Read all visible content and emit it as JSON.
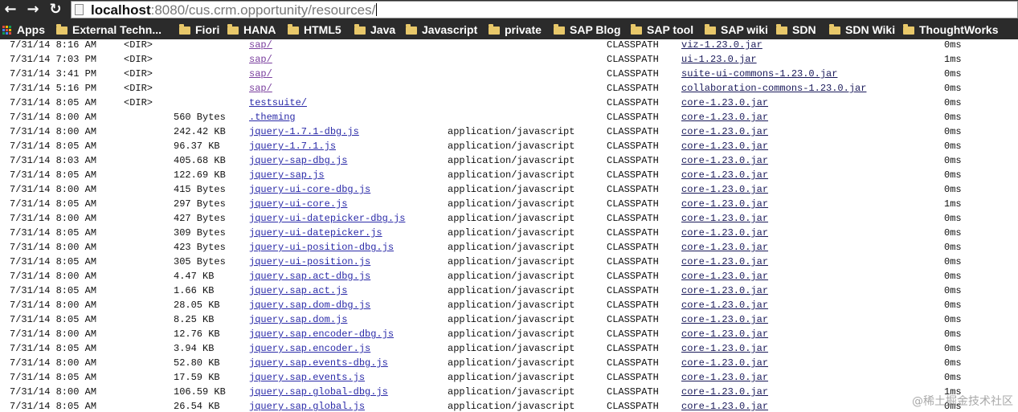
{
  "browser": {
    "back_icon": "←",
    "forward_icon": "→",
    "reload_icon": "↻",
    "url_host": "localhost",
    "url_rest": ":8080/cus.crm.opportunity/resources/"
  },
  "bookmarks": [
    {
      "label": "Apps",
      "icon": "apps-grid-icon"
    },
    {
      "label": "External Techn...",
      "icon": "folder-icon"
    },
    {
      "label": "Fiori",
      "icon": "folder-icon"
    },
    {
      "label": "HANA",
      "icon": "folder-icon"
    },
    {
      "label": "HTML5",
      "icon": "folder-icon"
    },
    {
      "label": "Java",
      "icon": "folder-icon"
    },
    {
      "label": "Javascript",
      "icon": "folder-icon"
    },
    {
      "label": "private",
      "icon": "folder-icon"
    },
    {
      "label": "SAP Blog",
      "icon": "folder-icon"
    },
    {
      "label": "SAP tool",
      "icon": "folder-icon"
    },
    {
      "label": "SAP wiki",
      "icon": "folder-icon"
    },
    {
      "label": "SDN",
      "icon": "folder-icon"
    },
    {
      "label": "SDN Wiki",
      "icon": "folder-icon"
    },
    {
      "label": "ThoughtWorks",
      "icon": "folder-icon"
    }
  ],
  "rows": [
    {
      "date": "7/31/14 8:16 AM",
      "dir": "<DIR>",
      "size": "",
      "name": "sap/",
      "mime": "",
      "cp": "CLASSPATH",
      "jar": "viz-1.23.0.jar",
      "time": "0ms"
    },
    {
      "date": "7/31/14 7:03 PM",
      "dir": "<DIR>",
      "size": "",
      "name": "sap/",
      "mime": "",
      "cp": "CLASSPATH",
      "jar": "ui-1.23.0.jar",
      "time": "1ms"
    },
    {
      "date": "7/31/14 3:41 PM",
      "dir": "<DIR>",
      "size": "",
      "name": "sap/",
      "mime": "",
      "cp": "CLASSPATH",
      "jar": "suite-ui-commons-1.23.0.jar",
      "time": "0ms"
    },
    {
      "date": "7/31/14 5:16 PM",
      "dir": "<DIR>",
      "size": "",
      "name": "sap/",
      "mime": "",
      "cp": "CLASSPATH",
      "jar": "collaboration-commons-1.23.0.jar",
      "time": "0ms"
    },
    {
      "date": "7/31/14 8:05 AM",
      "dir": "<DIR>",
      "size": "",
      "name": "testsuite/",
      "mime": "",
      "cp": "CLASSPATH",
      "jar": "core-1.23.0.jar",
      "time": "0ms"
    },
    {
      "date": "7/31/14 8:00 AM",
      "dir": "",
      "size": "560 Bytes",
      "name": ".theming",
      "mime": "",
      "cp": "CLASSPATH",
      "jar": "core-1.23.0.jar",
      "time": "0ms"
    },
    {
      "date": "7/31/14 8:00 AM",
      "dir": "",
      "size": "242.42 KB",
      "name": "jquery-1.7.1-dbg.js",
      "mime": "application/javascript",
      "cp": "CLASSPATH",
      "jar": "core-1.23.0.jar",
      "time": "0ms"
    },
    {
      "date": "7/31/14 8:05 AM",
      "dir": "",
      "size": "96.37 KB",
      "name": "jquery-1.7.1.js",
      "mime": "application/javascript",
      "cp": "CLASSPATH",
      "jar": "core-1.23.0.jar",
      "time": "0ms"
    },
    {
      "date": "7/31/14 8:03 AM",
      "dir": "",
      "size": "405.68 KB",
      "name": "jquery-sap-dbg.js",
      "mime": "application/javascript",
      "cp": "CLASSPATH",
      "jar": "core-1.23.0.jar",
      "time": "0ms"
    },
    {
      "date": "7/31/14 8:05 AM",
      "dir": "",
      "size": "122.69 KB",
      "name": "jquery-sap.js",
      "mime": "application/javascript",
      "cp": "CLASSPATH",
      "jar": "core-1.23.0.jar",
      "time": "0ms"
    },
    {
      "date": "7/31/14 8:00 AM",
      "dir": "",
      "size": "415 Bytes",
      "name": "jquery-ui-core-dbg.js",
      "mime": "application/javascript",
      "cp": "CLASSPATH",
      "jar": "core-1.23.0.jar",
      "time": "0ms"
    },
    {
      "date": "7/31/14 8:05 AM",
      "dir": "",
      "size": "297 Bytes",
      "name": "jquery-ui-core.js",
      "mime": "application/javascript",
      "cp": "CLASSPATH",
      "jar": "core-1.23.0.jar",
      "time": "1ms"
    },
    {
      "date": "7/31/14 8:00 AM",
      "dir": "",
      "size": "427 Bytes",
      "name": "jquery-ui-datepicker-dbg.js",
      "mime": "application/javascript",
      "cp": "CLASSPATH",
      "jar": "core-1.23.0.jar",
      "time": "0ms"
    },
    {
      "date": "7/31/14 8:05 AM",
      "dir": "",
      "size": "309 Bytes",
      "name": "jquery-ui-datepicker.js",
      "mime": "application/javascript",
      "cp": "CLASSPATH",
      "jar": "core-1.23.0.jar",
      "time": "0ms"
    },
    {
      "date": "7/31/14 8:00 AM",
      "dir": "",
      "size": "423 Bytes",
      "name": "jquery-ui-position-dbg.js",
      "mime": "application/javascript",
      "cp": "CLASSPATH",
      "jar": "core-1.23.0.jar",
      "time": "0ms"
    },
    {
      "date": "7/31/14 8:05 AM",
      "dir": "",
      "size": "305 Bytes",
      "name": "jquery-ui-position.js",
      "mime": "application/javascript",
      "cp": "CLASSPATH",
      "jar": "core-1.23.0.jar",
      "time": "0ms"
    },
    {
      "date": "7/31/14 8:00 AM",
      "dir": "",
      "size": "4.47 KB",
      "name": "jquery.sap.act-dbg.js",
      "mime": "application/javascript",
      "cp": "CLASSPATH",
      "jar": "core-1.23.0.jar",
      "time": "0ms"
    },
    {
      "date": "7/31/14 8:05 AM",
      "dir": "",
      "size": "1.66 KB",
      "name": "jquery.sap.act.js",
      "mime": "application/javascript",
      "cp": "CLASSPATH",
      "jar": "core-1.23.0.jar",
      "time": "0ms"
    },
    {
      "date": "7/31/14 8:00 AM",
      "dir": "",
      "size": "28.05 KB",
      "name": "jquery.sap.dom-dbg.js",
      "mime": "application/javascript",
      "cp": "CLASSPATH",
      "jar": "core-1.23.0.jar",
      "time": "0ms"
    },
    {
      "date": "7/31/14 8:05 AM",
      "dir": "",
      "size": "8.25 KB",
      "name": "jquery.sap.dom.js",
      "mime": "application/javascript",
      "cp": "CLASSPATH",
      "jar": "core-1.23.0.jar",
      "time": "0ms"
    },
    {
      "date": "7/31/14 8:00 AM",
      "dir": "",
      "size": "12.76 KB",
      "name": "jquery.sap.encoder-dbg.js",
      "mime": "application/javascript",
      "cp": "CLASSPATH",
      "jar": "core-1.23.0.jar",
      "time": "0ms"
    },
    {
      "date": "7/31/14 8:05 AM",
      "dir": "",
      "size": "3.94 KB",
      "name": "jquery.sap.encoder.js",
      "mime": "application/javascript",
      "cp": "CLASSPATH",
      "jar": "core-1.23.0.jar",
      "time": "0ms"
    },
    {
      "date": "7/31/14 8:00 AM",
      "dir": "",
      "size": "52.80 KB",
      "name": "jquery.sap.events-dbg.js",
      "mime": "application/javascript",
      "cp": "CLASSPATH",
      "jar": "core-1.23.0.jar",
      "time": "0ms"
    },
    {
      "date": "7/31/14 8:05 AM",
      "dir": "",
      "size": "17.59 KB",
      "name": "jquery.sap.events.js",
      "mime": "application/javascript",
      "cp": "CLASSPATH",
      "jar": "core-1.23.0.jar",
      "time": "0ms"
    },
    {
      "date": "7/31/14 8:00 AM",
      "dir": "",
      "size": "106.59 KB",
      "name": "jquery.sap.global-dbg.js",
      "mime": "application/javascript",
      "cp": "CLASSPATH",
      "jar": "core-1.23.0.jar",
      "time": "1ms"
    },
    {
      "date": "7/31/14 8:05 AM",
      "dir": "",
      "size": "26.54 KB",
      "name": "jquery.sap.global.js",
      "mime": "application/javascript",
      "cp": "CLASSPATH",
      "jar": "core-1.23.0.jar",
      "time": "0ms"
    }
  ],
  "watermark": "@稀土掘金技术社区"
}
